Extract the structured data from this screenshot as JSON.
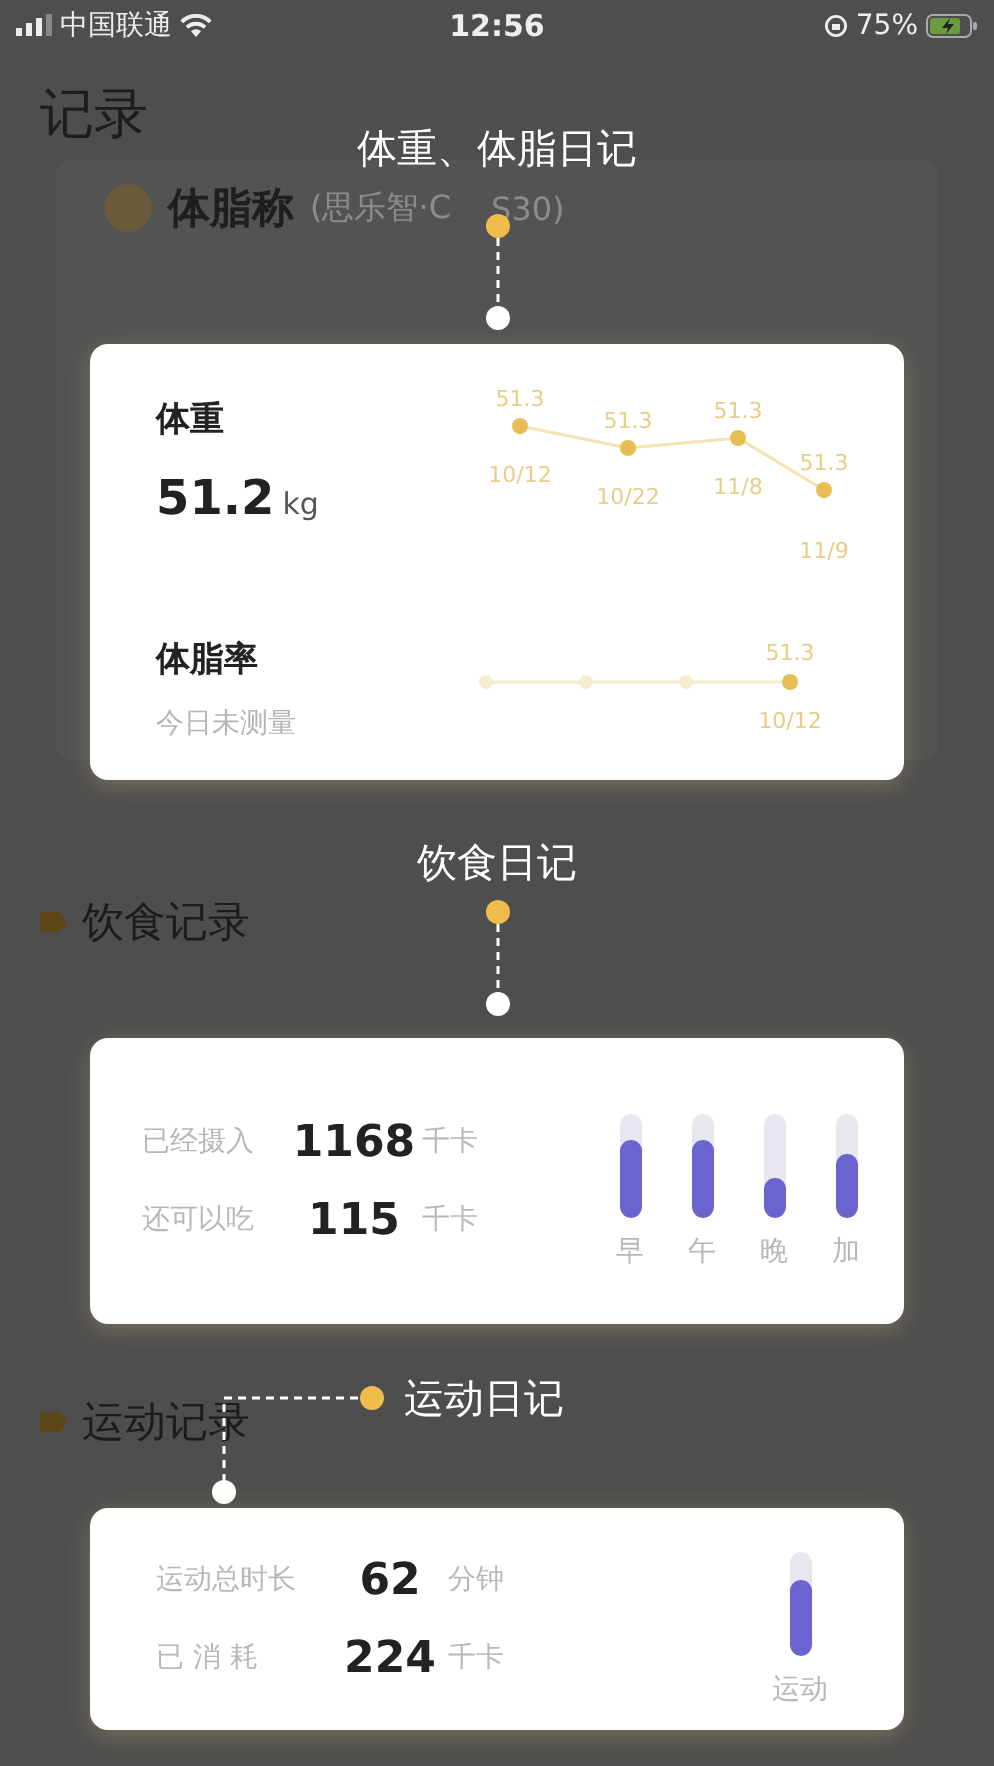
{
  "status_bar": {
    "carrier": "中国联通",
    "time": "12:56",
    "battery": "75%"
  },
  "page": {
    "title": "记录",
    "device_name": "体脂称",
    "device_model": [
      "(思乐智·C",
      "S30)"
    ],
    "sections": [
      {
        "title": "饮食记录"
      },
      {
        "title": "运动记录"
      }
    ]
  },
  "guides": [
    {
      "label": "体重、体脂日记"
    },
    {
      "label": "饮食日记"
    },
    {
      "label": "运动日记"
    }
  ],
  "weight_card": {
    "weight_label": "体重",
    "weight_value": "51.2",
    "weight_unit": "kg",
    "weight_points": [
      {
        "value": "51.3",
        "date": "10/12"
      },
      {
        "value": "51.3",
        "date": "10/22"
      },
      {
        "value": "51.3",
        "date": "11/8"
      },
      {
        "value": "51.3",
        "date": "11/9"
      }
    ],
    "fat_label": "体脂率",
    "fat_status": "今日未测量",
    "fat_point": {
      "value": "51.3",
      "date": "10/12"
    }
  },
  "diet_card": {
    "rows": [
      {
        "label": "已经摄入",
        "value": "1168",
        "unit": "千卡"
      },
      {
        "label": "还可以吃",
        "value": "115",
        "unit": "千卡"
      }
    ],
    "meals": [
      {
        "label": "早",
        "level": 0.75
      },
      {
        "label": "午",
        "level": 0.75
      },
      {
        "label": "晚",
        "level": 0.38
      },
      {
        "label": "加",
        "level": 0.6
      }
    ]
  },
  "exercise_card": {
    "rows": [
      {
        "label": "运动总时长",
        "value": "62",
        "unit": "分钟"
      },
      {
        "label": "已 消 耗",
        "value": "224",
        "unit": "千卡"
      }
    ],
    "bar": {
      "label": "运动",
      "level": 0.72
    }
  }
}
